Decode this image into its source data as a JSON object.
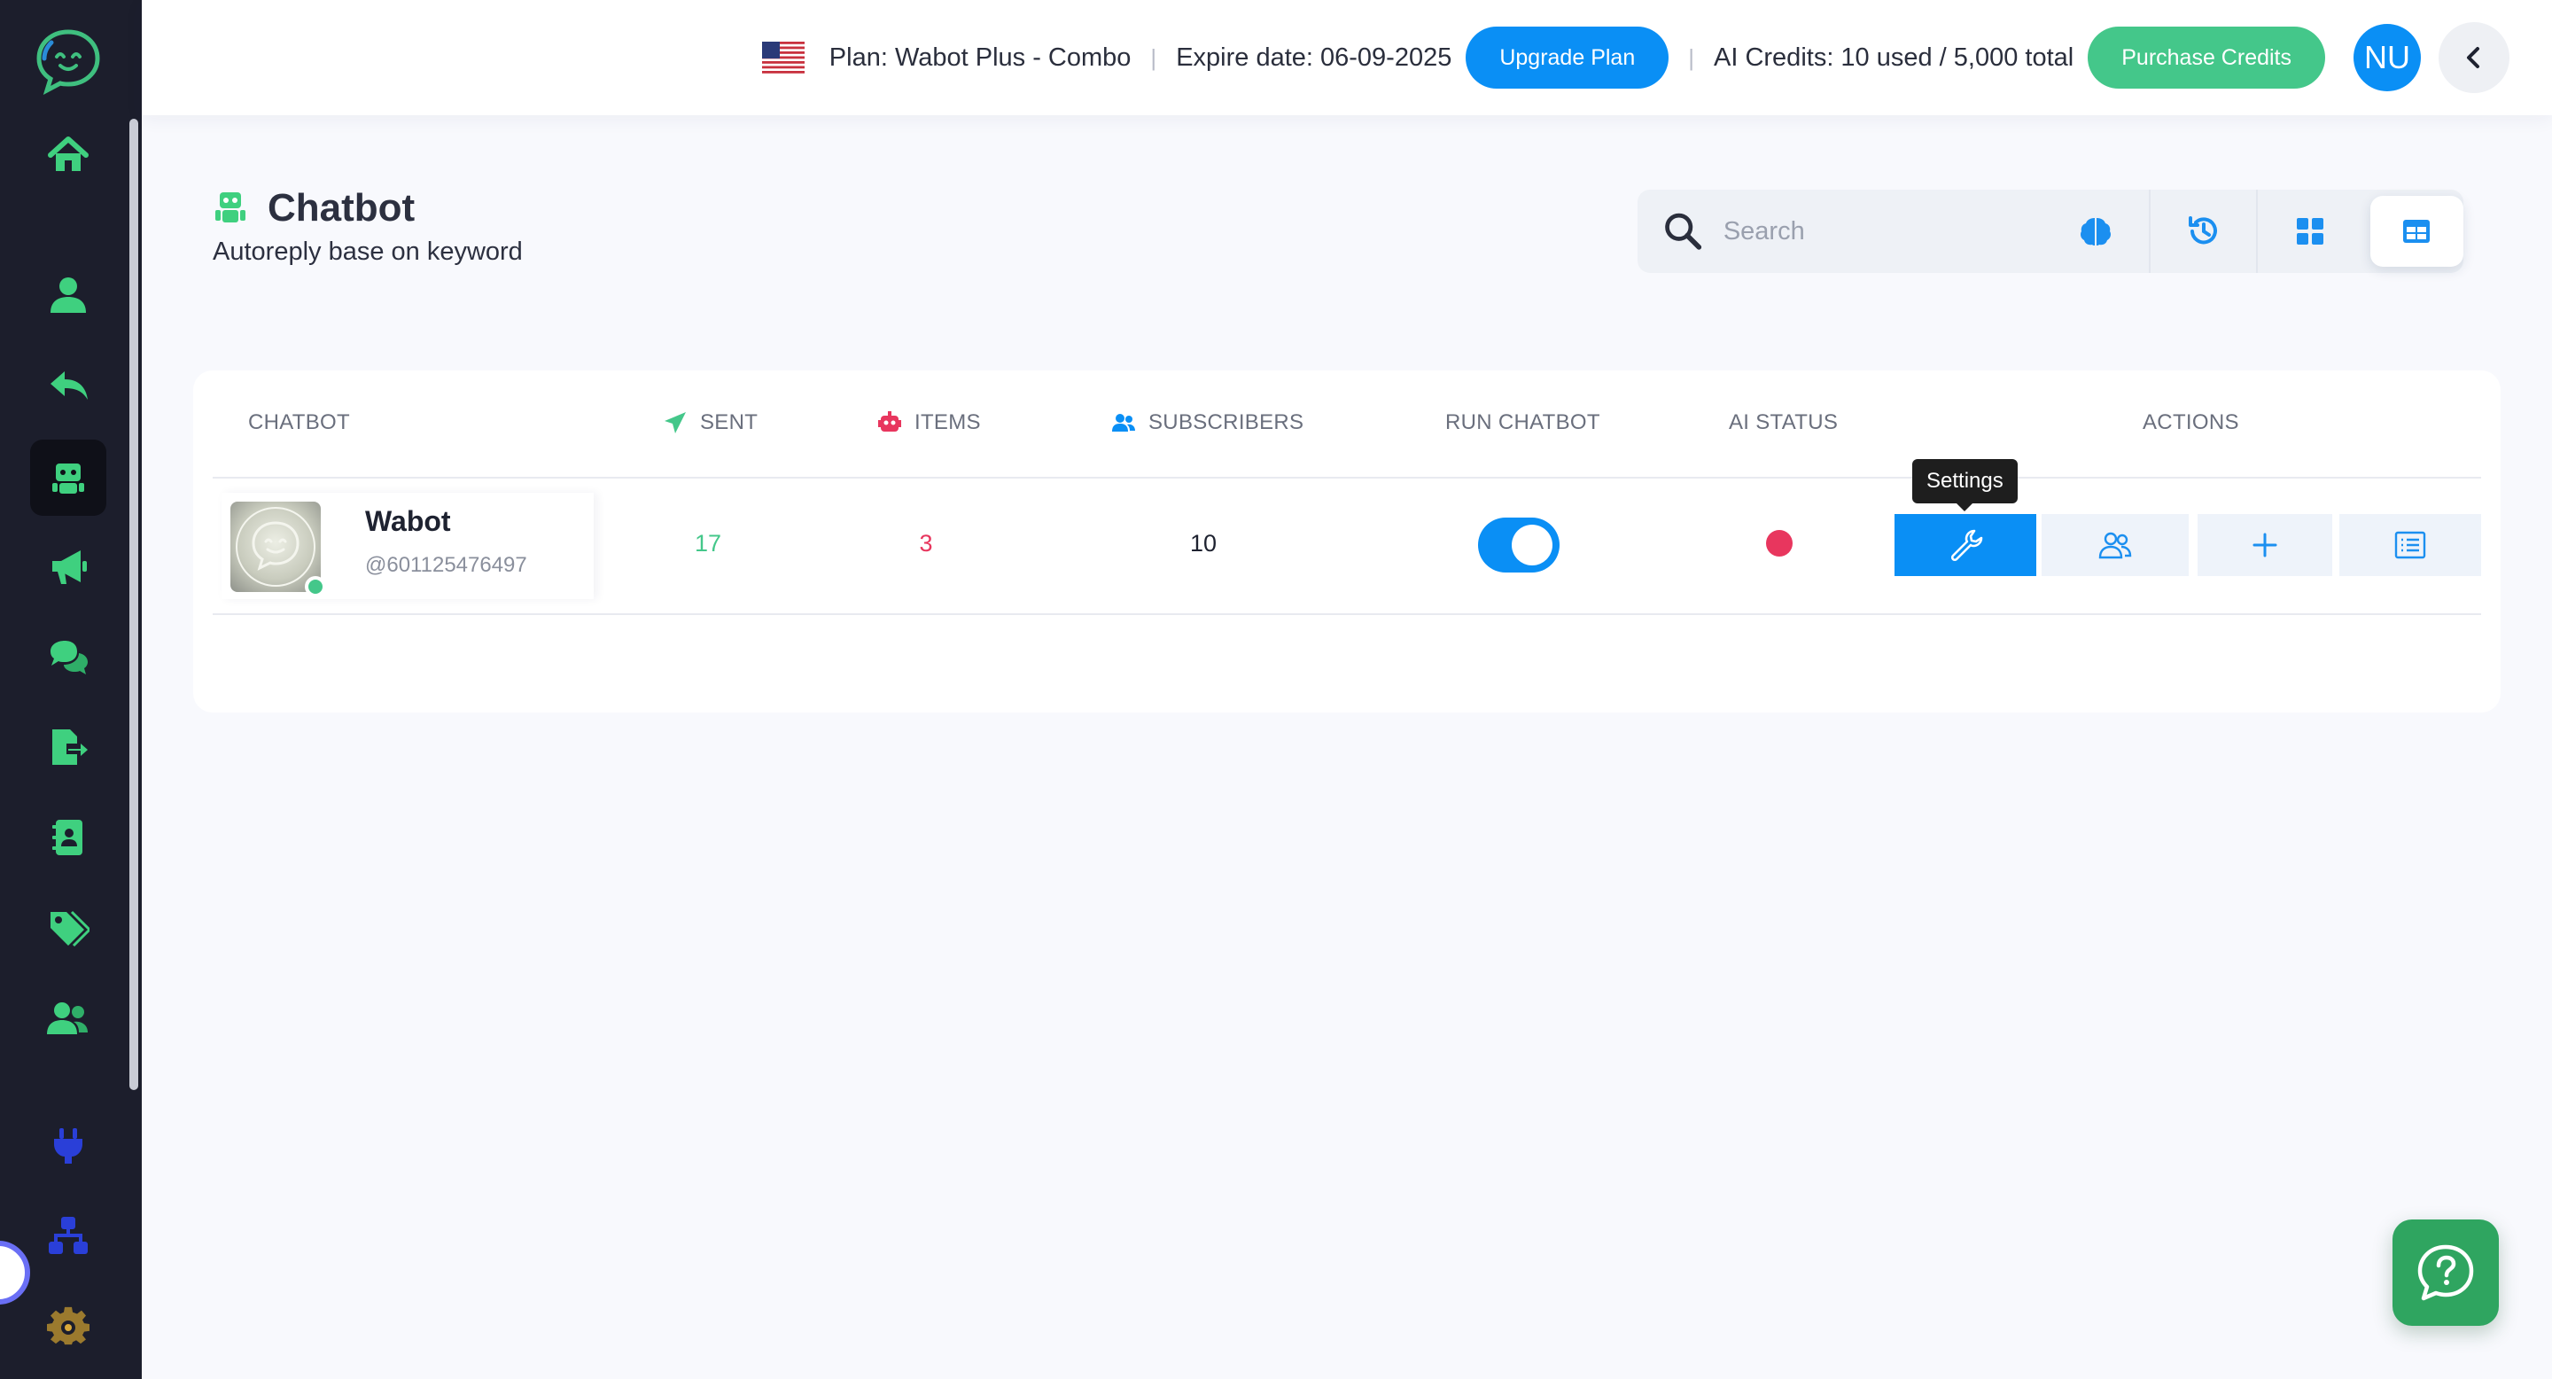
{
  "header": {
    "plan_text": "Plan: Wabot Plus - Combo",
    "separator": "|",
    "expire_text": "Expire date: 06-09-2025",
    "upgrade_label": "Upgrade Plan",
    "credits_text": "AI Credits: 10 used / 5,000 total",
    "purchase_label": "Purchase Credits",
    "avatar_initials": "NU"
  },
  "page": {
    "title": "Chatbot",
    "subtitle": "Autoreply base on keyword"
  },
  "search": {
    "placeholder": "Search"
  },
  "table": {
    "columns": {
      "chatbot": "CHATBOT",
      "sent": "SENT",
      "items": "ITEMS",
      "subscribers": "SUBSCRIBERS",
      "run": "RUN CHATBOT",
      "ai_status": "AI STATUS",
      "actions": "ACTIONS"
    },
    "rows": [
      {
        "name": "Wabot",
        "handle": "@601125476497",
        "sent": "17",
        "items": "3",
        "subscribers": "10",
        "run_chatbot": true,
        "ai_status_color": "#e8365e"
      }
    ],
    "tooltip": "Settings"
  },
  "colors": {
    "primary": "#0a8ff5",
    "green": "#44c78a",
    "sidebar_bg": "#1c1e2c",
    "danger": "#e8365e"
  },
  "icons": {
    "sidebar": [
      "home-icon",
      "user-icon",
      "reply-icon",
      "robot-icon",
      "megaphone-icon",
      "chat-icon",
      "export-icon",
      "contact-book-icon",
      "tags-icon",
      "team-icon",
      "plug-icon",
      "sitemap-icon",
      "gear-icon"
    ],
    "toolbar": [
      "search-icon",
      "brain-icon",
      "history-icon",
      "grid-icon",
      "table-icon"
    ],
    "actions": [
      "wrench-icon",
      "users-icon",
      "plus-icon",
      "list-icon"
    ]
  }
}
